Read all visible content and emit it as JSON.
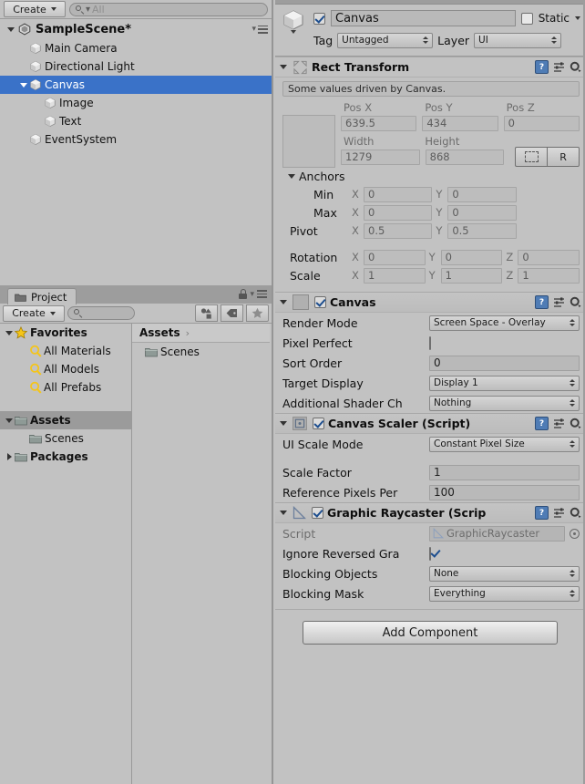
{
  "hierarchy": {
    "create_label": "Create",
    "search_placeholder": "All",
    "search_icon": "search-icon",
    "menu_icon": "pane-menu-icon",
    "scene_name": "SampleScene*",
    "scene_icon": "unity-scene-icon",
    "items": [
      {
        "label": "Main Camera",
        "indent": 1,
        "expandable": false,
        "selected": false,
        "icon": "gameobject-cube-icon"
      },
      {
        "label": "Directional Light",
        "indent": 1,
        "expandable": false,
        "selected": false,
        "icon": "gameobject-cube-icon"
      },
      {
        "label": "Canvas",
        "indent": 1,
        "expandable": true,
        "expanded": true,
        "selected": true,
        "icon": "gameobject-cube-icon"
      },
      {
        "label": "Image",
        "indent": 2,
        "expandable": false,
        "selected": false,
        "icon": "gameobject-cube-icon"
      },
      {
        "label": "Text",
        "indent": 2,
        "expandable": false,
        "selected": false,
        "icon": "gameobject-cube-icon"
      },
      {
        "label": "EventSystem",
        "indent": 1,
        "expandable": false,
        "selected": false,
        "icon": "gameobject-cube-icon"
      }
    ]
  },
  "project": {
    "tab_label": "Project",
    "tab_icon": "folder-icon",
    "lock_icon": "lock-icon",
    "menu_icon": "pane-menu-icon",
    "create_label": "Create",
    "search_placeholder": "",
    "toolbar_buttons": [
      {
        "name": "filter-by-type-icon"
      },
      {
        "name": "filter-by-label-icon"
      },
      {
        "name": "favorite-star-icon"
      }
    ],
    "tree": [
      {
        "label": "Favorites",
        "icon": "star-icon",
        "indent": 0,
        "expandable": true,
        "expanded": true,
        "bold": true,
        "selected": false
      },
      {
        "label": "All Materials",
        "icon": "saved-search-icon",
        "indent": 1,
        "expandable": false,
        "bold": false,
        "selected": false
      },
      {
        "label": "All Models",
        "icon": "saved-search-icon",
        "indent": 1,
        "expandable": false,
        "bold": false,
        "selected": false
      },
      {
        "label": "All Prefabs",
        "icon": "saved-search-icon",
        "indent": 1,
        "expandable": false,
        "bold": false,
        "selected": false
      },
      {
        "label": "",
        "icon": "",
        "indent": 0,
        "spacer": true
      },
      {
        "label": "Assets",
        "icon": "folder-icon",
        "indent": 0,
        "expandable": true,
        "expanded": true,
        "bold": true,
        "selected": true
      },
      {
        "label": "Scenes",
        "icon": "folder-icon",
        "indent": 1,
        "expandable": false,
        "bold": false,
        "selected": false
      },
      {
        "label": "Packages",
        "icon": "folder-icon",
        "indent": 0,
        "expandable": true,
        "expanded": false,
        "bold": true,
        "selected": false
      }
    ],
    "breadcrumb": "Assets",
    "breadcrumb_arrow": "›",
    "contents": [
      {
        "label": "Scenes",
        "icon": "folder-icon"
      }
    ]
  },
  "inspector": {
    "object_icon": "gameobject-cube-icon",
    "enabled": true,
    "name": "Canvas",
    "static_label": "Static",
    "static_checked": false,
    "tag_label": "Tag",
    "tag_value": "Untagged",
    "layer_label": "Layer",
    "layer_value": "UI",
    "rect_transform": {
      "title": "Rect Transform",
      "icon": "rect-transform-anchor-icon",
      "help_icon": "help-icon",
      "preset_icon": "preset-icon",
      "gear_icon": "gear-icon",
      "driven_note": "Some values driven by Canvas.",
      "pos_labels": [
        "Pos X",
        "Pos Y",
        "Pos Z"
      ],
      "pos_values": [
        "639.5",
        "434",
        "0"
      ],
      "size_labels": [
        "Width",
        "Height"
      ],
      "size_values": [
        "1279",
        "868"
      ],
      "blueprint_button": "blueprint-mode-icon",
      "raw_button": "R",
      "anchors_label": "Anchors",
      "anchor_min_label": "Min",
      "anchor_min": {
        "x": "0",
        "y": "0"
      },
      "anchor_max_label": "Max",
      "anchor_max": {
        "x": "0",
        "y": "0"
      },
      "pivot_label": "Pivot",
      "pivot": {
        "x": "0.5",
        "y": "0.5"
      },
      "rotation_label": "Rotation",
      "rotation": {
        "x": "0",
        "y": "0",
        "z": "0"
      },
      "scale_label": "Scale",
      "scale": {
        "x": "1",
        "y": "1",
        "z": "1"
      },
      "axis_x": "X",
      "axis_y": "Y",
      "axis_z": "Z"
    },
    "canvas": {
      "title": "Canvas",
      "icon": "canvas-component-icon",
      "enabled": true,
      "rows": [
        {
          "label": "Render Mode",
          "type": "popup",
          "value": "Screen Space - Overlay"
        },
        {
          "label": "Pixel Perfect",
          "type": "checkbox",
          "value": false
        },
        {
          "label": "Sort Order",
          "type": "text",
          "value": "0"
        },
        {
          "label": "Target Display",
          "type": "popup",
          "value": "Display 1"
        },
        {
          "label": "Additional Shader Ch",
          "type": "popup",
          "value": "Nothing"
        }
      ]
    },
    "canvas_scaler": {
      "title": "Canvas Scaler (Script)",
      "icon": "canvas-scaler-icon",
      "enabled": true,
      "rows": [
        {
          "label": "UI Scale Mode",
          "type": "popup",
          "value": "Constant Pixel Size"
        },
        {
          "label": "",
          "type": "spacer",
          "value": ""
        },
        {
          "label": "Scale Factor",
          "type": "text",
          "value": "1"
        },
        {
          "label": "Reference Pixels Per",
          "type": "text",
          "value": "100"
        }
      ]
    },
    "graphic_raycaster": {
      "title": "Graphic Raycaster (Scrip",
      "icon": "graphic-raycaster-icon",
      "enabled": true,
      "script_label": "Script",
      "script_value": "GraphicRaycaster",
      "rows": [
        {
          "label": "Ignore Reversed Gra",
          "type": "checkbox",
          "value": true
        },
        {
          "label": "Blocking Objects",
          "type": "popup",
          "value": "None"
        },
        {
          "label": "Blocking Mask",
          "type": "popup",
          "value": "Everything"
        }
      ]
    },
    "add_component_label": "Add Component"
  },
  "colors": {
    "panel_bg": "#c2c2c2",
    "chrome_bg": "#9d9d9d",
    "selection_blue": "#3a72c8",
    "field_bg": "#b9b9b9",
    "text": "#111111",
    "muted_text": "#6c6c6c"
  }
}
